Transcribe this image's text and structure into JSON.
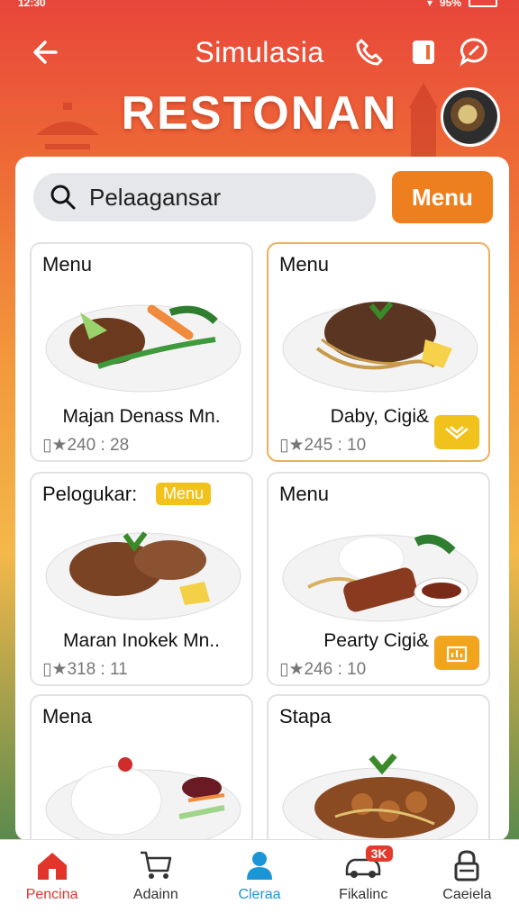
{
  "status": {
    "time": "12:30",
    "battery": "95%"
  },
  "header": {
    "title": "Simulasia"
  },
  "brand": {
    "name": "RESTONAN"
  },
  "search": {
    "value": "Pelaagansar",
    "button_label": "Menu"
  },
  "cards": [
    {
      "label": "Menu",
      "tag": "",
      "name": "Majan Denass Mn.",
      "stats": "▯★240 : 28",
      "selected": false
    },
    {
      "label": "Menu",
      "tag": "",
      "name": "Daby, Cigi&",
      "stats": "▯★245 : 10",
      "selected": true
    },
    {
      "label": "Pelogukar:",
      "tag": "Menu",
      "name": "Maran Inokek Mn..",
      "stats": "▯★318 : 11",
      "selected": false
    },
    {
      "label": "Menu",
      "tag": "",
      "name": "Pearty Cigi&",
      "stats": "▯★246 : 10",
      "selected": false
    },
    {
      "label": "Mena",
      "tag": "",
      "name": "",
      "stats": "",
      "selected": false
    },
    {
      "label": "Stapa",
      "tag": "",
      "name": "",
      "stats": "",
      "selected": false
    }
  ],
  "nav": [
    {
      "label": "Pencina",
      "icon": "home-icon",
      "badge": ""
    },
    {
      "label": "Adainn",
      "icon": "cart-icon",
      "badge": ""
    },
    {
      "label": "Cleraa",
      "icon": "user-icon",
      "badge": ""
    },
    {
      "label": "Fikalinc",
      "icon": "car-icon",
      "badge": "3K"
    },
    {
      "label": "Caeiela",
      "icon": "lock-icon",
      "badge": ""
    }
  ],
  "colors": {
    "accent": "#ee7f1e",
    "header_red": "#e8463a",
    "active_nav": "#e0352b",
    "tag_yellow": "#f2c21c"
  }
}
